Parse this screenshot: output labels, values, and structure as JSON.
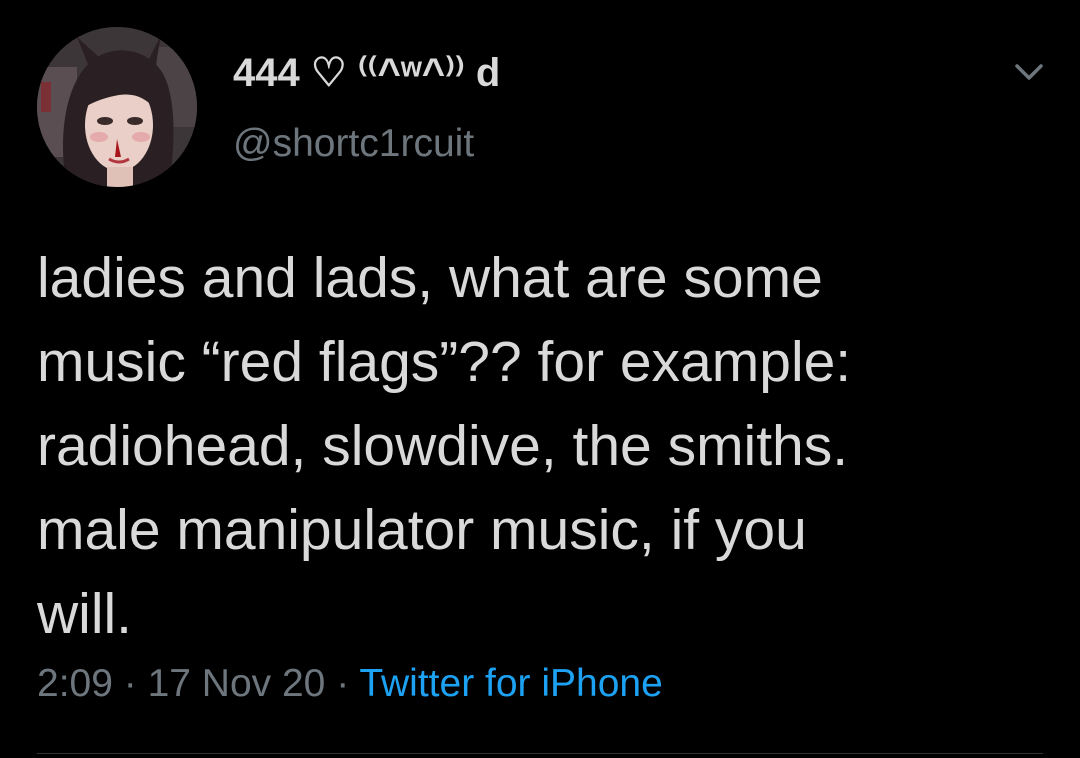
{
  "author": {
    "display_name": "444 ♡ ⁽⁽^ʷ^⁾⁾ d",
    "handle": "@shortc1rcuit"
  },
  "tweet": {
    "lines": [
      "ladies and lads, what are some",
      "music “red flags”?? for example:",
      "radiohead, slowdive, the smiths.",
      "male manipulator music, if you",
      "will."
    ]
  },
  "meta": {
    "time": "2:09",
    "separator": " · ",
    "date": "17 Nov 20",
    "source": "Twitter for iPhone"
  },
  "icons": {
    "caret": "chevron-down-icon"
  },
  "colors": {
    "background": "#000000",
    "text": "#d9d9d9",
    "secondary": "#6e767d",
    "link": "#1da1f2",
    "divider": "#2f3336"
  }
}
